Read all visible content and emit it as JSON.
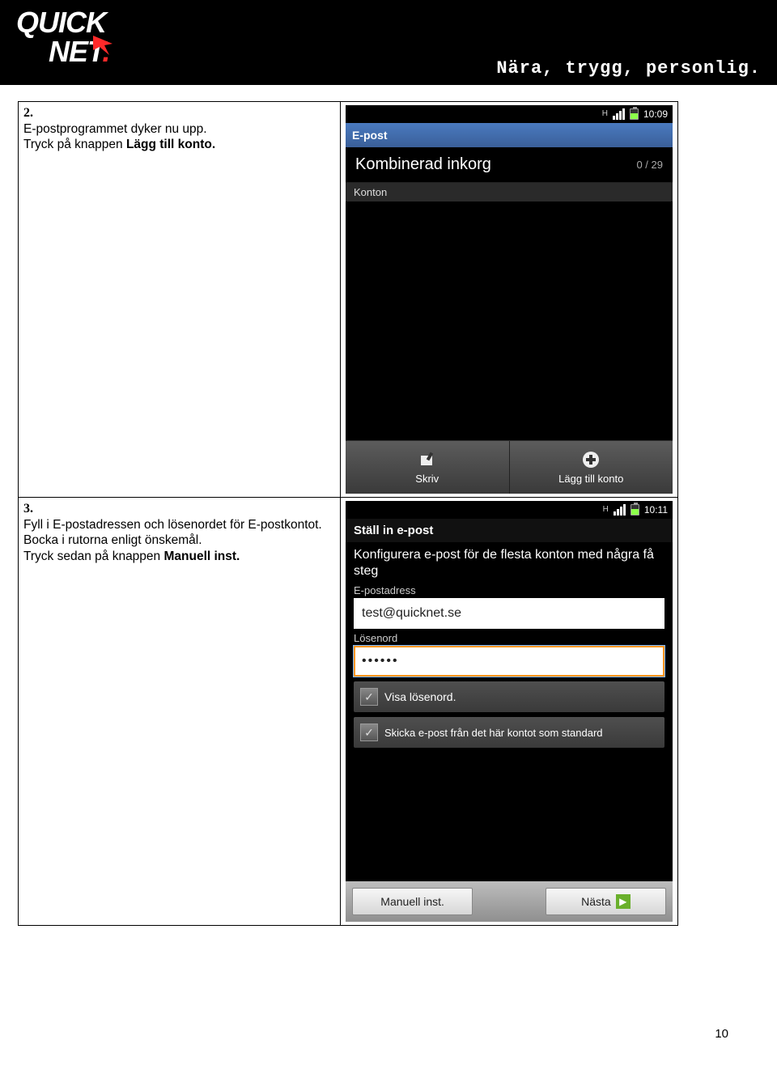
{
  "header": {
    "logo_line1": "QUICK",
    "logo_line2": "NET",
    "logo_dot": ".",
    "tagline": "Nära, trygg, personlig."
  },
  "step2": {
    "num": "2.",
    "line1": "E-postprogrammet dyker nu upp.",
    "line2a": "Tryck på knappen ",
    "line2b": "Lägg till konto."
  },
  "step3": {
    "num": "3.",
    "line1": "Fyll i E-postadressen och lösenordet för E-postkontot.",
    "line2": "Bocka i rutorna enligt önskemål.",
    "line3a": "Tryck sedan på knappen ",
    "line3b": "Manuell inst."
  },
  "shot1": {
    "status_h": "H",
    "time": "10:09",
    "appbar": "E-post",
    "inbox_title": "Kombinerad inkorg",
    "inbox_count": "0 / 29",
    "section_accounts": "Konton",
    "btn_write": "Skriv",
    "btn_add": "Lägg till konto"
  },
  "shot2": {
    "status_h": "H",
    "time": "10:11",
    "title": "Ställ in e-post",
    "desc": "Konfigurera e-post för de flesta konton med några få steg",
    "label_email": "E-postadress",
    "value_email": "test@quicknet.se",
    "label_password": "Lösenord",
    "value_password": "••••••",
    "check_show": "Visa lösenord.",
    "check_default": "Skicka e-post från det här kontot som standard",
    "btn_manual": "Manuell inst.",
    "btn_next": "Nästa"
  },
  "page_number": "10"
}
